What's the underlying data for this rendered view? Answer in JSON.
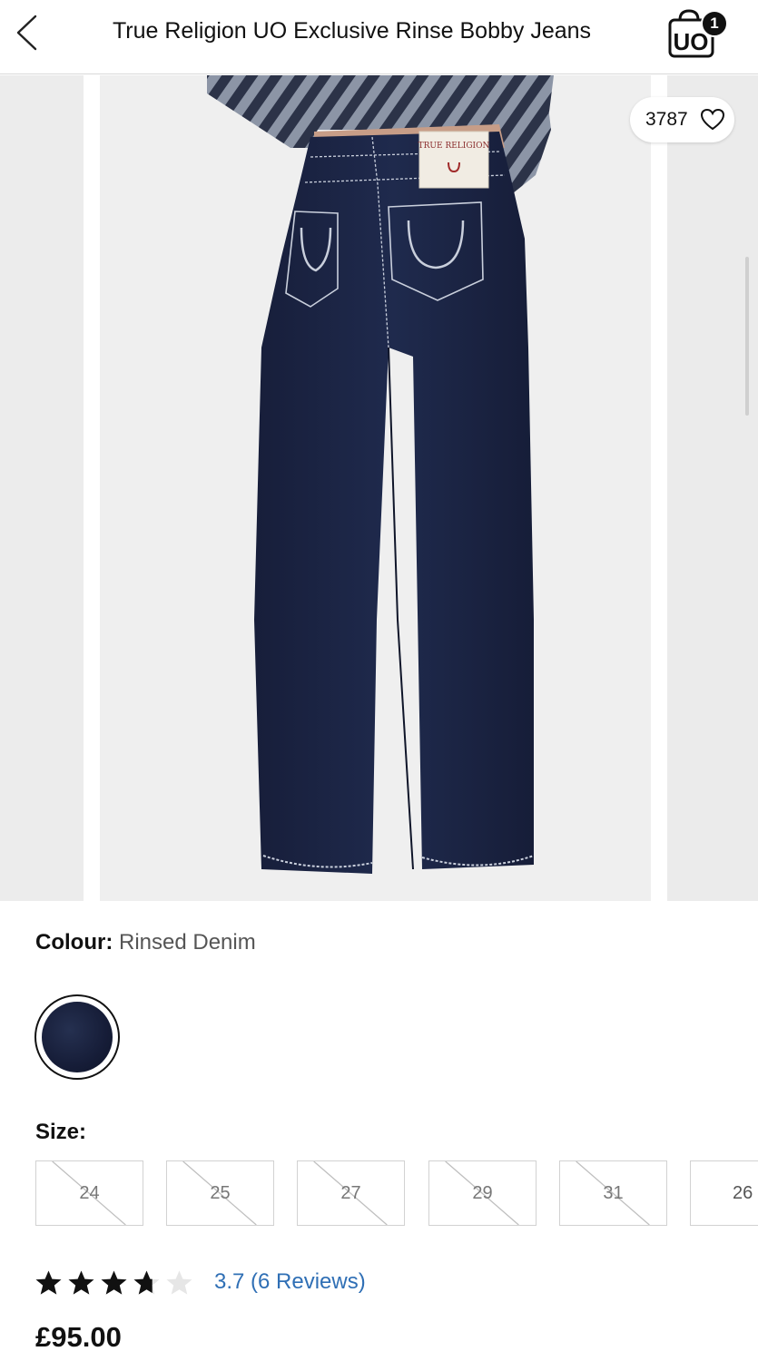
{
  "header": {
    "title": "True Religion UO Exclusive Rinse Bobby Jeans",
    "bag_brand": "UO",
    "bag_count": "1"
  },
  "gallery": {
    "like_count": "3787",
    "label_text": "TRUE RELIGION"
  },
  "product": {
    "colour_label": "Colour:",
    "colour_value": "Rinsed Denim",
    "size_label": "Size:",
    "sizes": [
      "24",
      "25",
      "27",
      "29",
      "31",
      "26"
    ],
    "sizes_unavailable": [
      true,
      true,
      true,
      true,
      true,
      false
    ],
    "rating": {
      "value": 3.7,
      "max": 5,
      "text": "3.7 (6 Reviews)"
    },
    "price": "£95.00"
  },
  "colors": {
    "accent_link": "#2f6fb5",
    "denim": "#1b2442",
    "text": "#111111"
  },
  "icons": {
    "back": "chevron-left-icon",
    "bag": "shopping-bag-icon",
    "like": "heart-icon",
    "star": "star-icon"
  }
}
